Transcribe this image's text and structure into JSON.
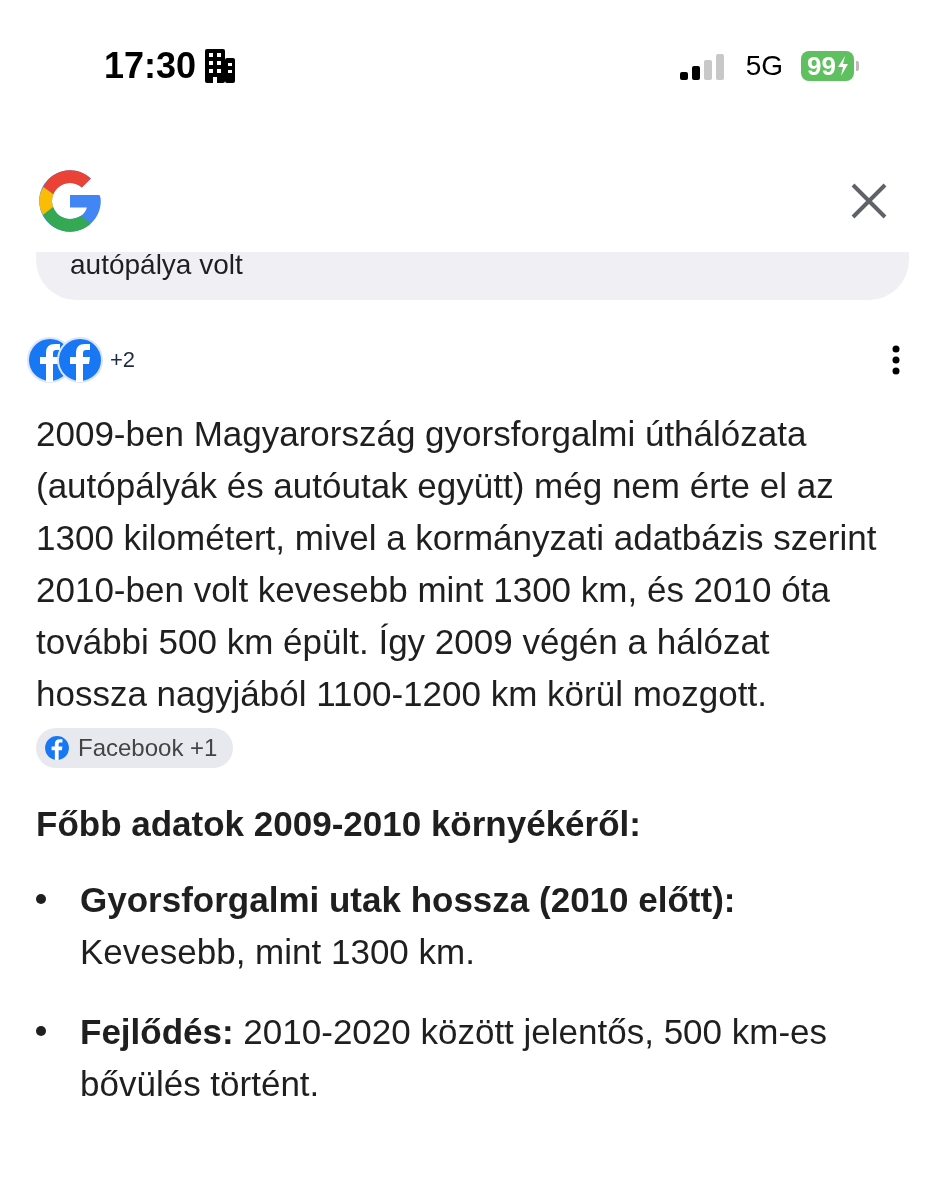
{
  "status_bar": {
    "time": "17:30",
    "network": "5G",
    "battery": "99"
  },
  "query_card": {
    "text": "autópálya volt"
  },
  "sources": {
    "more": "+2"
  },
  "answer": {
    "paragraph": "2009-ben Magyarország gyorsforgalmi úthálózata (autópályák és autóutak együtt) még nem érte el az 1300 kilométert, mivel a kormányzati adatbázis szerint 2010-ben volt kevesebb mint 1300 km, és 2010 óta további 500 km épült. Így 2009 végén a hálózat hossza nagyjából 1100-1200 km körül mozgott.",
    "chip": "Facebook +1"
  },
  "heading": "Főbb adatok 2009-2010 környékéről:",
  "bullets": [
    {
      "text": "**Gyorsforgalmi utak hossza (2010 előtt):** Kevesebb, mint 1300 km."
    },
    {
      "text": "**Fejlődés:** 2010-2020 között jelentős, 500 km-es bővülés történt."
    }
  ]
}
